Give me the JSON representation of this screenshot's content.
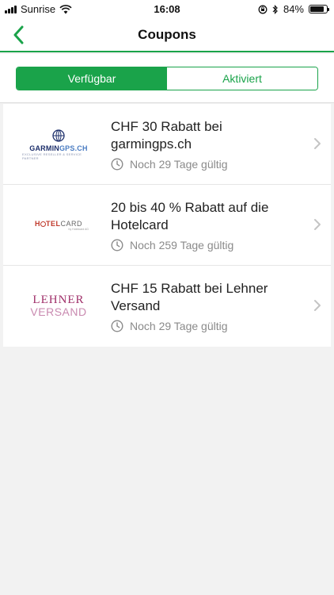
{
  "status_bar": {
    "carrier": "Sunrise",
    "time": "16:08",
    "battery_percent": "84%",
    "battery_level": 0.84
  },
  "nav": {
    "title": "Coupons",
    "back_icon": "chevron-left-icon",
    "accent_color": "#1aa34a"
  },
  "tabs": [
    {
      "label": "Verfügbar",
      "active": true
    },
    {
      "label": "Aktiviert",
      "active": false
    }
  ],
  "coupons": [
    {
      "title": "CHF 30 Rabatt bei garmingps.ch",
      "validity": "Noch 29 Tage gültig",
      "logo": {
        "text_main": "GARMIN",
        "text_accent": "GPS.CH",
        "subtext": "EXCLUSIVE RESELLER & SERVICE PARTNER"
      }
    },
    {
      "title": "20 bis 40 % Rabatt auf die Hotelcard",
      "validity": "Noch 259 Tage gültig",
      "logo": {
        "text_h": "H",
        "text_tel": "TEL",
        "text_card": "CARD",
        "subtext": "by Hotelcard AG"
      }
    },
    {
      "title": "CHF 15 Rabatt bei Lehner Versand",
      "validity": "Noch 29 Tage gültig",
      "logo": {
        "text_top": "LEHNER",
        "text_bottom": "VERSAND"
      }
    }
  ]
}
